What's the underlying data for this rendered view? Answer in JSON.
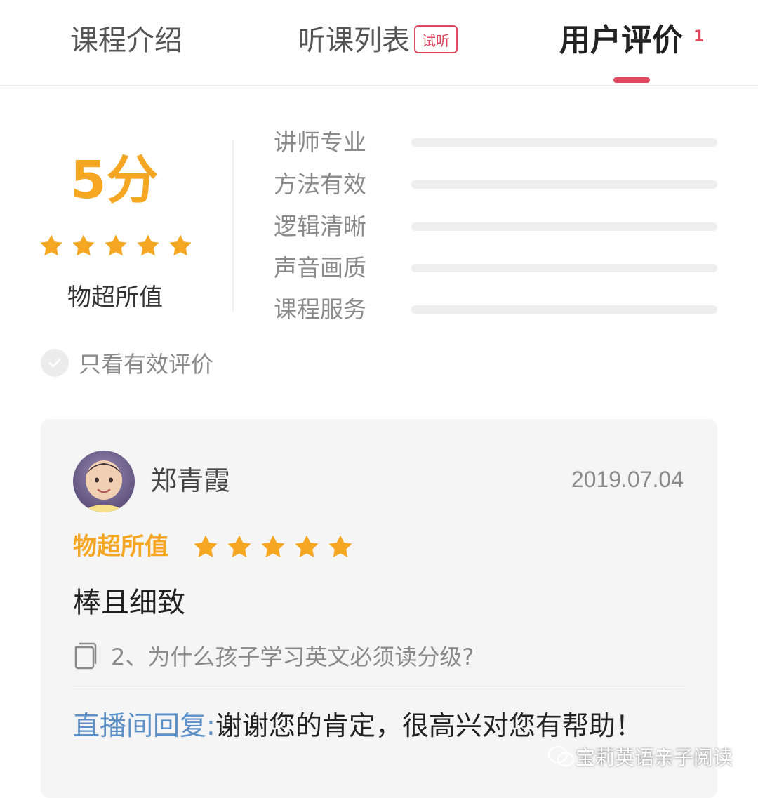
{
  "tabs": [
    {
      "label": "课程介绍",
      "active": false
    },
    {
      "label": "听课列表",
      "badge": "试听",
      "active": false
    },
    {
      "label": "用户评价",
      "count": "1",
      "active": true
    }
  ],
  "summary": {
    "score": "5分",
    "stars": 5,
    "label": "物超所值",
    "ratings": [
      {
        "label": "讲师专业",
        "value": 0
      },
      {
        "label": "方法有效",
        "value": 0
      },
      {
        "label": "逻辑清晰",
        "value": 0
      },
      {
        "label": "声音画质",
        "value": 0
      },
      {
        "label": "课程服务",
        "value": 0
      }
    ]
  },
  "filter": {
    "label": "只看有效评价",
    "checked": false
  },
  "review": {
    "username": "郑青霞",
    "date": "2019.07.04",
    "tag": "物超所值",
    "stars": 5,
    "text": "棒且细致",
    "lesson": "2、为什么孩子学习英文必须读分级?",
    "reply_prefix": "直播间回复:",
    "reply_text": "谢谢您的肯定，很高兴对您有帮助！"
  },
  "watermark": "宝莉英语亲子阅读",
  "colors": {
    "accent": "#e0485f",
    "star": "#f5a623",
    "reply_link": "#5b8fc7"
  }
}
